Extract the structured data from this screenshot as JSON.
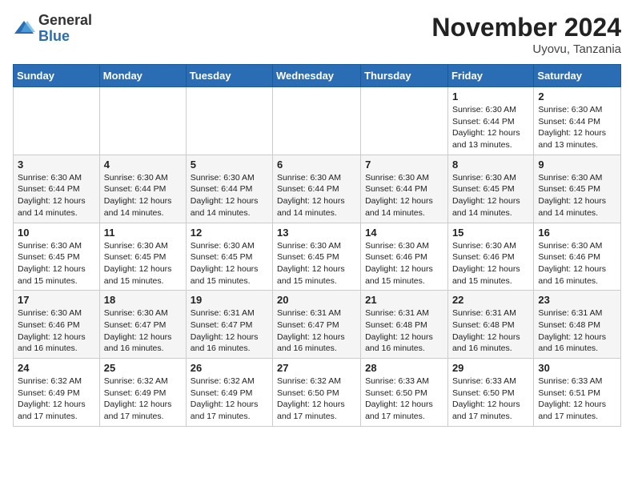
{
  "logo": {
    "general": "General",
    "blue": "Blue"
  },
  "header": {
    "month": "November 2024",
    "location": "Uyovu, Tanzania"
  },
  "weekdays": [
    "Sunday",
    "Monday",
    "Tuesday",
    "Wednesday",
    "Thursday",
    "Friday",
    "Saturday"
  ],
  "weeks": [
    [
      {
        "day": "",
        "info": ""
      },
      {
        "day": "",
        "info": ""
      },
      {
        "day": "",
        "info": ""
      },
      {
        "day": "",
        "info": ""
      },
      {
        "day": "",
        "info": ""
      },
      {
        "day": "1",
        "info": "Sunrise: 6:30 AM\nSunset: 6:44 PM\nDaylight: 12 hours\nand 13 minutes."
      },
      {
        "day": "2",
        "info": "Sunrise: 6:30 AM\nSunset: 6:44 PM\nDaylight: 12 hours\nand 13 minutes."
      }
    ],
    [
      {
        "day": "3",
        "info": "Sunrise: 6:30 AM\nSunset: 6:44 PM\nDaylight: 12 hours\nand 14 minutes."
      },
      {
        "day": "4",
        "info": "Sunrise: 6:30 AM\nSunset: 6:44 PM\nDaylight: 12 hours\nand 14 minutes."
      },
      {
        "day": "5",
        "info": "Sunrise: 6:30 AM\nSunset: 6:44 PM\nDaylight: 12 hours\nand 14 minutes."
      },
      {
        "day": "6",
        "info": "Sunrise: 6:30 AM\nSunset: 6:44 PM\nDaylight: 12 hours\nand 14 minutes."
      },
      {
        "day": "7",
        "info": "Sunrise: 6:30 AM\nSunset: 6:44 PM\nDaylight: 12 hours\nand 14 minutes."
      },
      {
        "day": "8",
        "info": "Sunrise: 6:30 AM\nSunset: 6:45 PM\nDaylight: 12 hours\nand 14 minutes."
      },
      {
        "day": "9",
        "info": "Sunrise: 6:30 AM\nSunset: 6:45 PM\nDaylight: 12 hours\nand 14 minutes."
      }
    ],
    [
      {
        "day": "10",
        "info": "Sunrise: 6:30 AM\nSunset: 6:45 PM\nDaylight: 12 hours\nand 15 minutes."
      },
      {
        "day": "11",
        "info": "Sunrise: 6:30 AM\nSunset: 6:45 PM\nDaylight: 12 hours\nand 15 minutes."
      },
      {
        "day": "12",
        "info": "Sunrise: 6:30 AM\nSunset: 6:45 PM\nDaylight: 12 hours\nand 15 minutes."
      },
      {
        "day": "13",
        "info": "Sunrise: 6:30 AM\nSunset: 6:45 PM\nDaylight: 12 hours\nand 15 minutes."
      },
      {
        "day": "14",
        "info": "Sunrise: 6:30 AM\nSunset: 6:46 PM\nDaylight: 12 hours\nand 15 minutes."
      },
      {
        "day": "15",
        "info": "Sunrise: 6:30 AM\nSunset: 6:46 PM\nDaylight: 12 hours\nand 15 minutes."
      },
      {
        "day": "16",
        "info": "Sunrise: 6:30 AM\nSunset: 6:46 PM\nDaylight: 12 hours\nand 16 minutes."
      }
    ],
    [
      {
        "day": "17",
        "info": "Sunrise: 6:30 AM\nSunset: 6:46 PM\nDaylight: 12 hours\nand 16 minutes."
      },
      {
        "day": "18",
        "info": "Sunrise: 6:30 AM\nSunset: 6:47 PM\nDaylight: 12 hours\nand 16 minutes."
      },
      {
        "day": "19",
        "info": "Sunrise: 6:31 AM\nSunset: 6:47 PM\nDaylight: 12 hours\nand 16 minutes."
      },
      {
        "day": "20",
        "info": "Sunrise: 6:31 AM\nSunset: 6:47 PM\nDaylight: 12 hours\nand 16 minutes."
      },
      {
        "day": "21",
        "info": "Sunrise: 6:31 AM\nSunset: 6:48 PM\nDaylight: 12 hours\nand 16 minutes."
      },
      {
        "day": "22",
        "info": "Sunrise: 6:31 AM\nSunset: 6:48 PM\nDaylight: 12 hours\nand 16 minutes."
      },
      {
        "day": "23",
        "info": "Sunrise: 6:31 AM\nSunset: 6:48 PM\nDaylight: 12 hours\nand 16 minutes."
      }
    ],
    [
      {
        "day": "24",
        "info": "Sunrise: 6:32 AM\nSunset: 6:49 PM\nDaylight: 12 hours\nand 17 minutes."
      },
      {
        "day": "25",
        "info": "Sunrise: 6:32 AM\nSunset: 6:49 PM\nDaylight: 12 hours\nand 17 minutes."
      },
      {
        "day": "26",
        "info": "Sunrise: 6:32 AM\nSunset: 6:49 PM\nDaylight: 12 hours\nand 17 minutes."
      },
      {
        "day": "27",
        "info": "Sunrise: 6:32 AM\nSunset: 6:50 PM\nDaylight: 12 hours\nand 17 minutes."
      },
      {
        "day": "28",
        "info": "Sunrise: 6:33 AM\nSunset: 6:50 PM\nDaylight: 12 hours\nand 17 minutes."
      },
      {
        "day": "29",
        "info": "Sunrise: 6:33 AM\nSunset: 6:50 PM\nDaylight: 12 hours\nand 17 minutes."
      },
      {
        "day": "30",
        "info": "Sunrise: 6:33 AM\nSunset: 6:51 PM\nDaylight: 12 hours\nand 17 minutes."
      }
    ]
  ]
}
